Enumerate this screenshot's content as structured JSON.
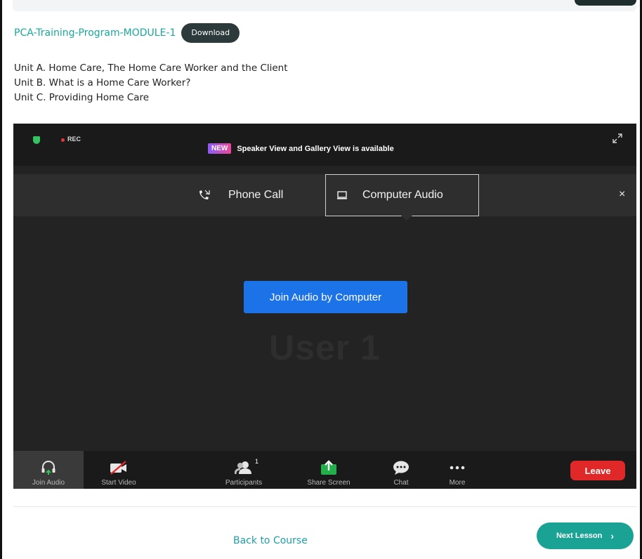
{
  "module": {
    "title": "PCA-Training-Program-MODULE-1",
    "download_label": "Download"
  },
  "units": [
    "Unit A. Home Care, The Home Care Worker and the Client",
    "Unit B. What is a Home Care Worker?",
    "Unit C. Providing Home Care"
  ],
  "meeting": {
    "rec_label": "REC",
    "new_badge": "NEW",
    "banner_text": "Speaker View and Gallery View is available",
    "audio_tabs": {
      "phone_label": "Phone Call",
      "computer_label": "Computer Audio"
    },
    "close_symbol": "×",
    "join_button": "Join Audio by Computer",
    "user_name": "User 1",
    "toolbar": {
      "join_audio": "Join Audio",
      "start_video": "Start Video",
      "participants": "Participants",
      "participants_count": "1",
      "share_screen": "Share Screen",
      "chat": "Chat",
      "more": "More",
      "leave": "Leave"
    }
  },
  "footer": {
    "back_label": "Back to Course",
    "next_label": "Next Lesson",
    "next_chevron": "›"
  },
  "colors": {
    "accent_teal": "#18a99b",
    "zoom_blue": "#1c73e8",
    "leave_red": "#e02828",
    "share_green": "#22b04a"
  }
}
